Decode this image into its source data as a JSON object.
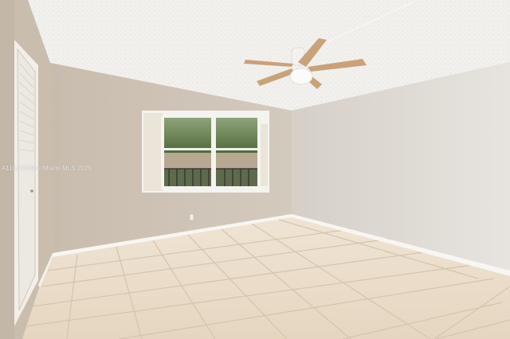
{
  "photo": {
    "subject": "empty-room",
    "watermark": "A11827649 © Miami MLS 2025"
  },
  "colors": {
    "ceiling": "#f3f2ef",
    "left_wall": "#cbbfb0",
    "back_wall": "#cfc5b8",
    "right_wall": "#dedad4",
    "floor_tile": "#eadcc8",
    "grout": "#d6c6b0",
    "baseboard": "#f7f6f3",
    "fan_blade": "#c9a27a",
    "window_frame": "#f4f3ef",
    "tree_green": "#4f6b3a"
  }
}
